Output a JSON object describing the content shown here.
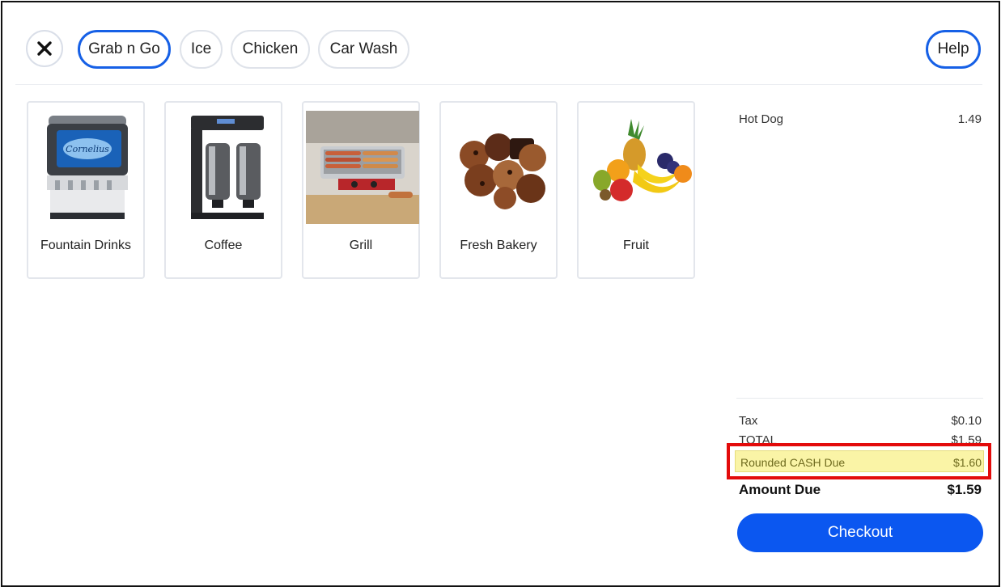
{
  "topbar": {
    "categories": [
      {
        "label": "Grab n Go",
        "active": true
      },
      {
        "label": "Ice",
        "active": false
      },
      {
        "label": "Chicken",
        "active": false
      },
      {
        "label": "Car Wash",
        "active": false
      }
    ],
    "help_label": "Help"
  },
  "products": [
    {
      "label": "Fountain Drinks",
      "icon": "fountain-drink-machine"
    },
    {
      "label": "Coffee",
      "icon": "coffee-brewer"
    },
    {
      "label": "Grill",
      "icon": "hot-dog-roller-grill"
    },
    {
      "label": "Fresh Bakery",
      "icon": "muffins-and-brownies"
    },
    {
      "label": "Fruit",
      "icon": "fruit-assortment"
    }
  ],
  "cart": {
    "items": [
      {
        "name": "Hot Dog",
        "price": "1.49"
      }
    ],
    "tax_label": "Tax",
    "tax_value": "$0.10",
    "total_label": "TOTAL",
    "total_value": "$1.59",
    "rounded_label": "Rounded CASH Due",
    "rounded_value": "$1.60",
    "amount_due_label": "Amount Due",
    "amount_due_value": "$1.59",
    "checkout_label": "Checkout"
  },
  "colors": {
    "accent": "#0b57f0",
    "chip_active_border": "#1660e6",
    "highlight_fill": "#faf4a6",
    "annotation_red": "#e30b0b"
  }
}
